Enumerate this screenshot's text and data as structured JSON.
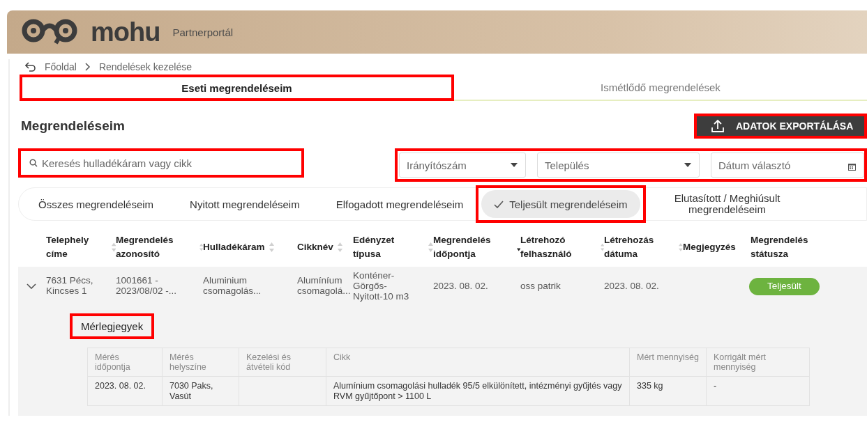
{
  "header": {
    "brand": "mohu",
    "subtitle": "Partnerportál"
  },
  "breadcrumb": [
    "Főoldal",
    "Rendelések kezelése"
  ],
  "tabs": [
    {
      "label": "Eseti megrendeléseim",
      "selected": true,
      "highlighted": true
    },
    {
      "label": "Ismétlődő megrendelések",
      "selected": false,
      "highlighted": false
    }
  ],
  "title": "Megrendeléseim",
  "export_button": {
    "label": "ADATOK EXPORTÁLÁSA",
    "highlighted": true
  },
  "search": {
    "placeholder": "Keresés hulladékáram vagy cikk",
    "highlighted": true
  },
  "filters": {
    "highlighted": true,
    "items": [
      {
        "kind": "select",
        "placeholder": "Irányítószám"
      },
      {
        "kind": "select",
        "placeholder": "Település"
      },
      {
        "kind": "date",
        "placeholder": "Dátum választó"
      }
    ]
  },
  "status_filters": [
    {
      "label": "Összes megrendeléseim",
      "selected": false,
      "highlighted": false
    },
    {
      "label": "Nyitott megrendeléseim",
      "selected": false,
      "highlighted": false
    },
    {
      "label": "Elfogadott megrendeléseim",
      "selected": false,
      "highlighted": false
    },
    {
      "label": "Teljesült megrendeléseim",
      "selected": true,
      "highlighted": true
    },
    {
      "label": "Elutasított / Meghiúsult megrendeléseim",
      "selected": false,
      "highlighted": false
    }
  ],
  "table": {
    "columns": [
      {
        "label": "Telephely címe",
        "sortable": true,
        "sorted": false
      },
      {
        "label": "Megrendelés azonosító",
        "sortable": true,
        "sorted": false
      },
      {
        "label": "Hulladékáram",
        "sortable": true,
        "sorted": false
      },
      {
        "label": "Cikknév",
        "sortable": true,
        "sorted": false
      },
      {
        "label": "Edényzet típusa",
        "sortable": true,
        "sorted": false
      },
      {
        "label": "Megrendelés időpontja",
        "sortable": true,
        "sorted": true
      },
      {
        "label": "Létrehozó felhasználó",
        "sortable": true,
        "sorted": false
      },
      {
        "label": "Létrehozás dátuma",
        "sortable": true,
        "sorted": false
      },
      {
        "label": "Megjegyzés",
        "sortable": false
      },
      {
        "label": "Megrendelés státusza",
        "sortable": false
      }
    ],
    "rows": [
      {
        "expanded": true,
        "cells": [
          "7631 Pécs, Kincses 1",
          "1001661 - 2023/08/02 -...",
          "Aluminium csomagolás...",
          "Alumíníum csomagolá...",
          "Konténer-Görgős-Nyitott-10 m3",
          "2023. 08. 02.",
          "oss patrik",
          "2023. 08. 02.",
          null
        ],
        "status": {
          "label": "Teljesült",
          "color": "#6db33f"
        },
        "detail": {
          "title": "Mérlegjegyek",
          "highlighted": true,
          "columns": [
            "Mérés időpontja",
            "Mérés helyszíne",
            "Kezelési és átvételi kód",
            "Cikk",
            "Mért mennyiség",
            "Korrigált mért mennyiség"
          ],
          "rows": [
            [
              "2023. 08. 02.",
              "7030 Paks, Vasút",
              null,
              "Alumínium csomagolási hulladék 95/5 elkülönített, intézményi gyűjtés vagy RVM gyűjtőpont > 1100 L",
              "335 kg",
              "-"
            ]
          ]
        }
      }
    ]
  }
}
